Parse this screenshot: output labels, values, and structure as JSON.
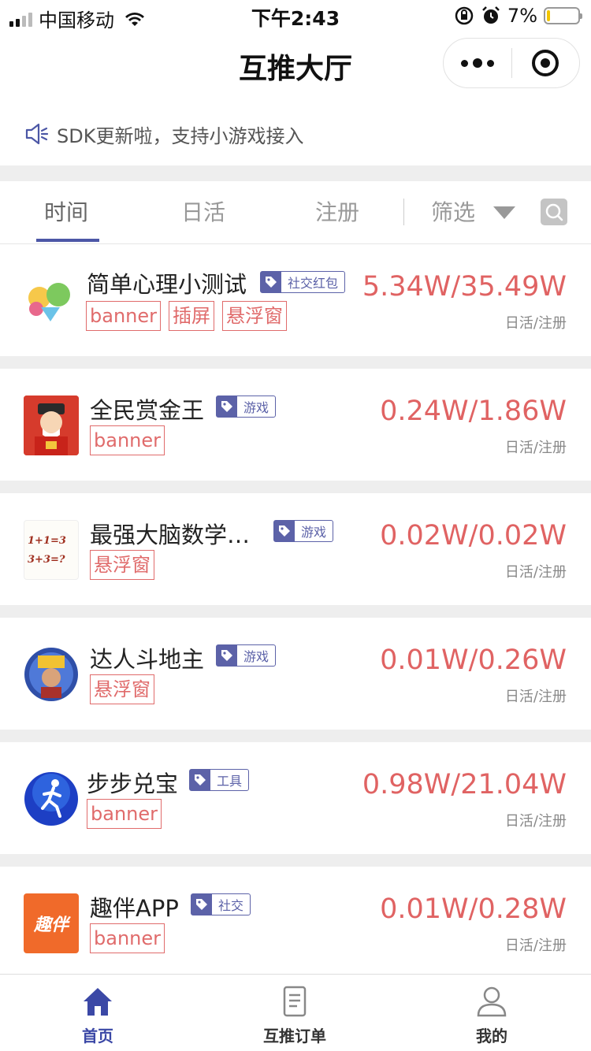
{
  "status_bar": {
    "carrier": "中国移动",
    "time": "下午2:43",
    "battery_percent": "7%",
    "battery_level": 0.07
  },
  "nav": {
    "title": "互推大厅"
  },
  "notice": {
    "text": "SDK更新啦，支持小游戏接入"
  },
  "tabs": {
    "time": "时间",
    "daily": "日活",
    "register": "注册",
    "filter": "筛选"
  },
  "list": [
    {
      "name": "简单心理小测试",
      "category": "社交红包",
      "ads": [
        "banner",
        "插屏",
        "悬浮窗"
      ],
      "stat": "5.34W/35.49W",
      "stat_label": "日活/注册"
    },
    {
      "name": "全民赏金王",
      "category": "游戏",
      "ads": [
        "banner"
      ],
      "stat": "0.24W/1.86W",
      "stat_label": "日活/注册"
    },
    {
      "name": "最强大脑数学…",
      "category": "游戏",
      "ads": [
        "悬浮窗"
      ],
      "stat": "0.02W/0.02W",
      "stat_label": "日活/注册"
    },
    {
      "name": "达人斗地主",
      "category": "游戏",
      "ads": [
        "悬浮窗"
      ],
      "stat": "0.01W/0.26W",
      "stat_label": "日活/注册"
    },
    {
      "name": "步步兑宝",
      "category": "工具",
      "ads": [
        "banner"
      ],
      "stat": "0.98W/21.04W",
      "stat_label": "日活/注册"
    },
    {
      "name": "趣伴APP",
      "category": "社交",
      "ads": [
        "banner"
      ],
      "stat": "0.01W/0.28W",
      "stat_label": "日活/注册"
    }
  ],
  "icon_text": {
    "math_line1": "1+1=3",
    "math_line2": "3+3=?",
    "qubao": "趣伴"
  },
  "tabbar": {
    "home": "首页",
    "orders": "互推订单",
    "mine": "我的"
  },
  "colors": {
    "accent": "#4c57a6",
    "stat": "#e06363",
    "tag": "#5c62a8"
  }
}
